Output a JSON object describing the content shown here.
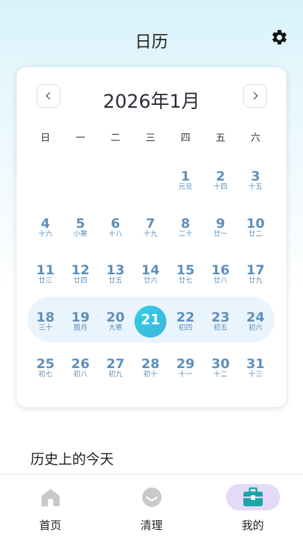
{
  "header": {
    "title": "日历",
    "settings_icon": "gear-icon"
  },
  "calendar": {
    "month_title": "2026年1月",
    "prev_icon": "chevron-left-icon",
    "next_icon": "chevron-right-icon",
    "weekdays": [
      "日",
      "一",
      "二",
      "三",
      "四",
      "五",
      "六"
    ],
    "first_weekday_index": 4,
    "today": 21,
    "selected_week_row": 3,
    "days": [
      {
        "d": "1",
        "l": "元旦"
      },
      {
        "d": "2",
        "l": "十四"
      },
      {
        "d": "3",
        "l": "十五"
      },
      {
        "d": "4",
        "l": "十六"
      },
      {
        "d": "5",
        "l": "小寒"
      },
      {
        "d": "6",
        "l": "十八"
      },
      {
        "d": "7",
        "l": "十九"
      },
      {
        "d": "8",
        "l": "二十"
      },
      {
        "d": "9",
        "l": "廿一"
      },
      {
        "d": "10",
        "l": "廿二"
      },
      {
        "d": "11",
        "l": "廿三"
      },
      {
        "d": "12",
        "l": "廿四"
      },
      {
        "d": "13",
        "l": "廿五"
      },
      {
        "d": "14",
        "l": "廿六"
      },
      {
        "d": "15",
        "l": "廿七"
      },
      {
        "d": "16",
        "l": "廿八"
      },
      {
        "d": "17",
        "l": "廿九"
      },
      {
        "d": "18",
        "l": "三十"
      },
      {
        "d": "19",
        "l": "腊月"
      },
      {
        "d": "20",
        "l": "大寒"
      },
      {
        "d": "21",
        "l": ""
      },
      {
        "d": "22",
        "l": "初四"
      },
      {
        "d": "23",
        "l": "初五"
      },
      {
        "d": "24",
        "l": "初六"
      },
      {
        "d": "25",
        "l": "初七"
      },
      {
        "d": "26",
        "l": "初八"
      },
      {
        "d": "27",
        "l": "初九"
      },
      {
        "d": "28",
        "l": "初十"
      },
      {
        "d": "29",
        "l": "十一"
      },
      {
        "d": "30",
        "l": "十二"
      },
      {
        "d": "31",
        "l": "十三"
      }
    ]
  },
  "history": {
    "title": "历史上的今天"
  },
  "tabbar": {
    "tabs": [
      {
        "label": "首页",
        "icon": "home-icon",
        "active": false
      },
      {
        "label": "清理",
        "icon": "clean-icon",
        "active": false
      },
      {
        "label": "我的",
        "icon": "toolbox-icon",
        "active": true
      }
    ]
  },
  "colors": {
    "accent_teal": "#3cc6df",
    "day_text": "#5f8fb9",
    "selected_row": "#e9f4fc",
    "active_tab": "#e4daf7"
  }
}
